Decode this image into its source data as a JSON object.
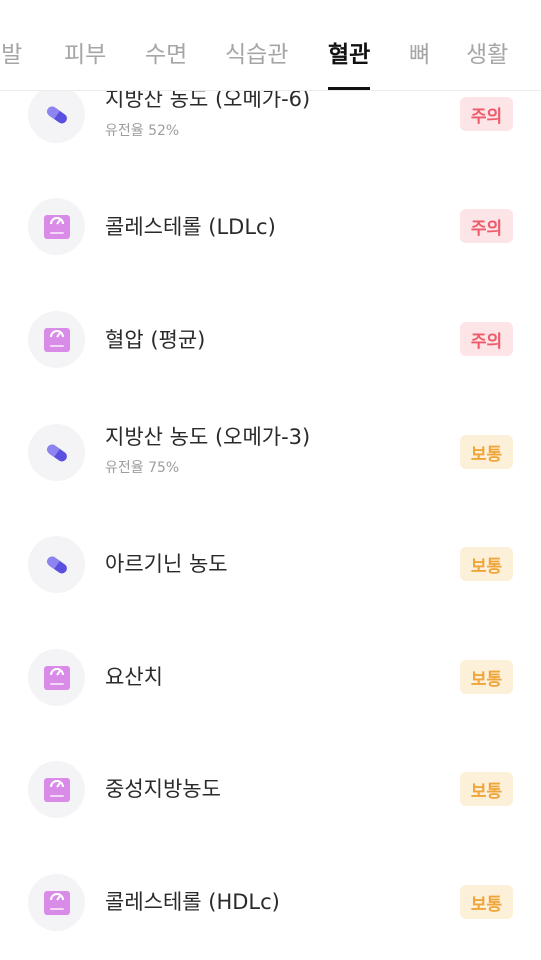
{
  "tabs": [
    {
      "label": "모발",
      "active": false
    },
    {
      "label": "피부",
      "active": false
    },
    {
      "label": "수면",
      "active": false
    },
    {
      "label": "식습관",
      "active": false
    },
    {
      "label": "혈관",
      "active": true
    },
    {
      "label": "뼈",
      "active": false
    },
    {
      "label": "생활",
      "active": false
    }
  ],
  "items": [
    {
      "title": "지방산 농도 (오메가-6)",
      "subtitle": "유전율 52%",
      "icon": "pill-icon",
      "badge": "주의",
      "status": "warn"
    },
    {
      "title": "콜레스테롤 (LDLc)",
      "subtitle": "",
      "icon": "scale-icon",
      "badge": "주의",
      "status": "warn"
    },
    {
      "title": "혈압 (평균)",
      "subtitle": "",
      "icon": "scale-icon",
      "badge": "주의",
      "status": "warn"
    },
    {
      "title": "지방산 농도 (오메가-3)",
      "subtitle": "유전율 75%",
      "icon": "pill-icon",
      "badge": "보통",
      "status": "normal"
    },
    {
      "title": "아르기닌 농도",
      "subtitle": "",
      "icon": "pill-icon",
      "badge": "보통",
      "status": "normal"
    },
    {
      "title": "요산치",
      "subtitle": "",
      "icon": "scale-icon",
      "badge": "보통",
      "status": "normal"
    },
    {
      "title": "중성지방농도",
      "subtitle": "",
      "icon": "scale-icon",
      "badge": "보통",
      "status": "normal"
    },
    {
      "title": "콜레스테롤 (HDLc)",
      "subtitle": "",
      "icon": "scale-icon",
      "badge": "보통",
      "status": "normal"
    }
  ],
  "colors": {
    "warn_bg": "#fde4e6",
    "warn_text": "#ee5a69",
    "normal_bg": "#fdf0d9",
    "normal_text": "#f0a53a",
    "pill_purple": "#5b4fe0",
    "scale_pink": "#d98be8"
  }
}
